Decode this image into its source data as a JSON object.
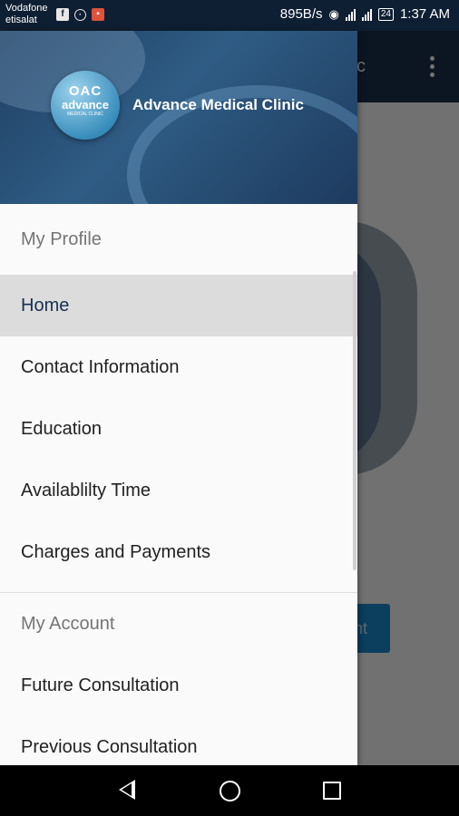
{
  "status_bar": {
    "carrier_1": "Vodafone",
    "carrier_2": "etisalat",
    "net_speed": "895B/s",
    "battery": "24",
    "time": "1:37 AM",
    "notification_icons": [
      "facebook-icon",
      "hotspot-icon",
      "app-icon"
    ]
  },
  "app_behind": {
    "toolbar_title_fragment": "c",
    "button_fragment": "nt"
  },
  "drawer": {
    "clinic_name": "Advance Medical Clinic",
    "logo": {
      "mark": "OAC",
      "text": "advance",
      "sub": "MEDICAL CLINIC"
    },
    "sections": [
      {
        "title": "My Profile",
        "items": [
          {
            "label": "Home",
            "active": true
          },
          {
            "label": "Contact Information",
            "active": false
          },
          {
            "label": "Education",
            "active": false
          },
          {
            "label": "Availablilty Time",
            "active": false
          },
          {
            "label": "Charges and Payments",
            "active": false
          }
        ]
      },
      {
        "title": "My Account",
        "items": [
          {
            "label": "Future Consultation",
            "active": false
          },
          {
            "label": "Previous Consultation",
            "active": false
          }
        ]
      }
    ]
  },
  "colors": {
    "toolbar": "#1b2f4d",
    "active_item_bg": "#dcdcdc",
    "active_item_text": "#172f52",
    "accent_button": "#1c8ad1"
  }
}
